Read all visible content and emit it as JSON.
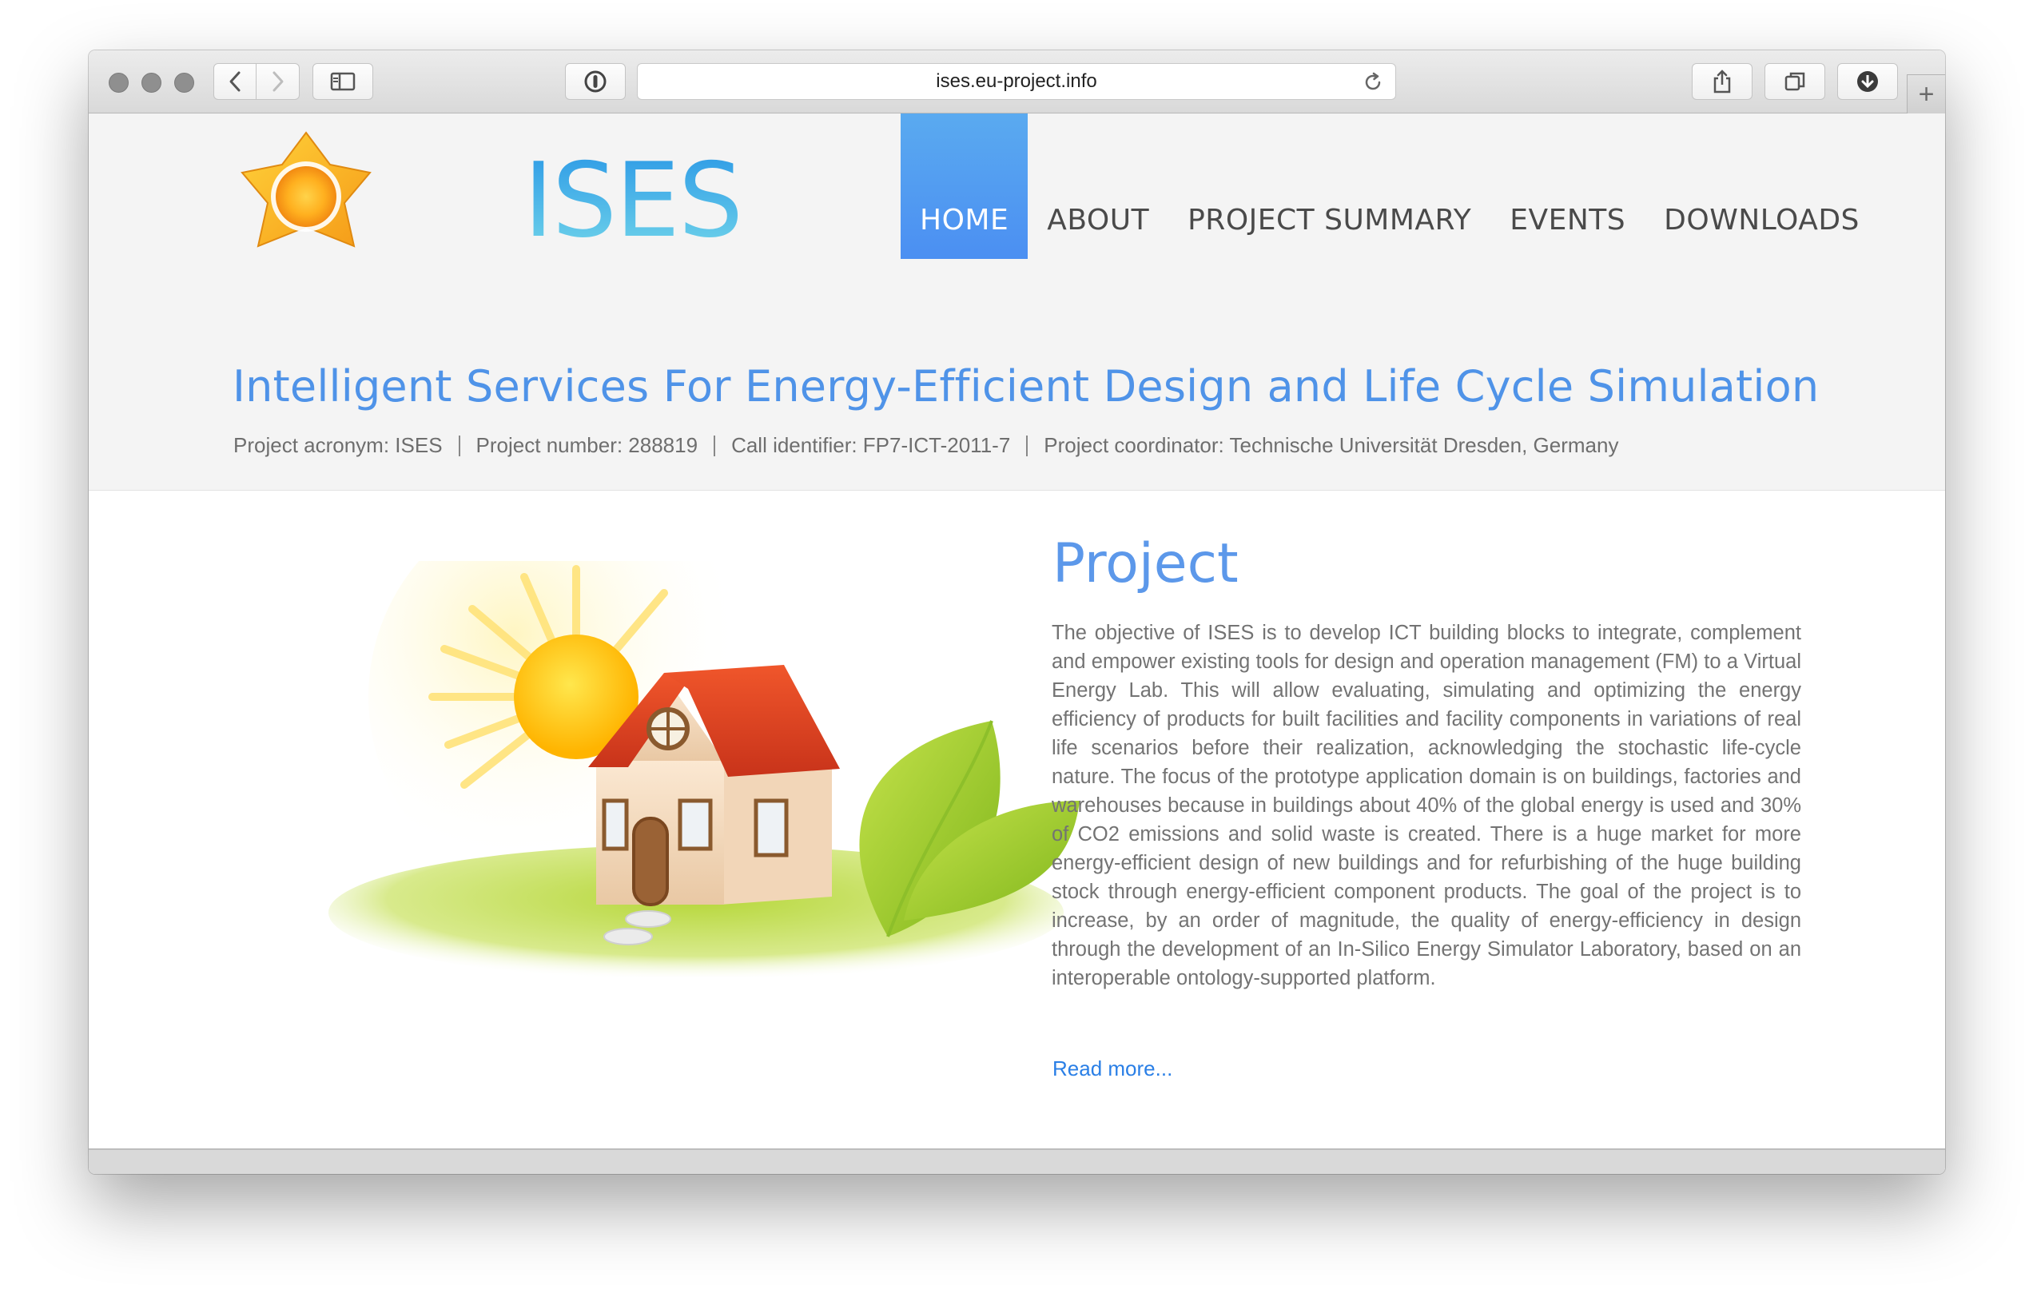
{
  "browser": {
    "url": "ises.eu-project.info"
  },
  "site": {
    "logo_text": "ISES",
    "nav": [
      {
        "label": "HOME"
      },
      {
        "label": "ABOUT"
      },
      {
        "label": "PROJECT SUMMARY"
      },
      {
        "label": "EVENTS"
      },
      {
        "label": "DOWNLOADS"
      }
    ],
    "active_nav": "HOME",
    "headline": "Intelligent Services For Energy-Efficient Design and Life Cycle Simulation",
    "meta": [
      "Project acronym: ISES",
      "Project number: 288819",
      "Call identifier: FP7-ICT-2011-7",
      "Project coordinator: Technische Universität Dresden, Germany"
    ]
  },
  "project": {
    "title": "Project",
    "body": "The objective of ISES is to develop ICT building blocks to integrate, complement and empower existing tools for design and operation management (FM) to a Virtual Energy Lab. This will allow evaluating, simulating and optimizing the energy efficiency of products for built facilities and facility components in variations of real life scenarios before their realization, acknowledging the stochastic life-cycle nature. The focus of the prototype application domain is on buildings, factories and warehouses because in buildings about 40% of the global energy is used and 30% of CO2 emissions and solid waste is created. There is a huge market for more energy-efficient design of new buildings and for refurbishing of the huge building stock through energy-efficient component products. The goal of the project is to increase, by an order of magnitude, the quality of energy-efficiency in design through the development of an In-Silico Energy Simulator Laboratory, based on an interoperable ontology-supported platform.",
    "read_more": "Read more..."
  },
  "colors": {
    "accent": "#4f93e8",
    "nav_active": "#4b8ff2",
    "link": "#2a7fe6"
  }
}
